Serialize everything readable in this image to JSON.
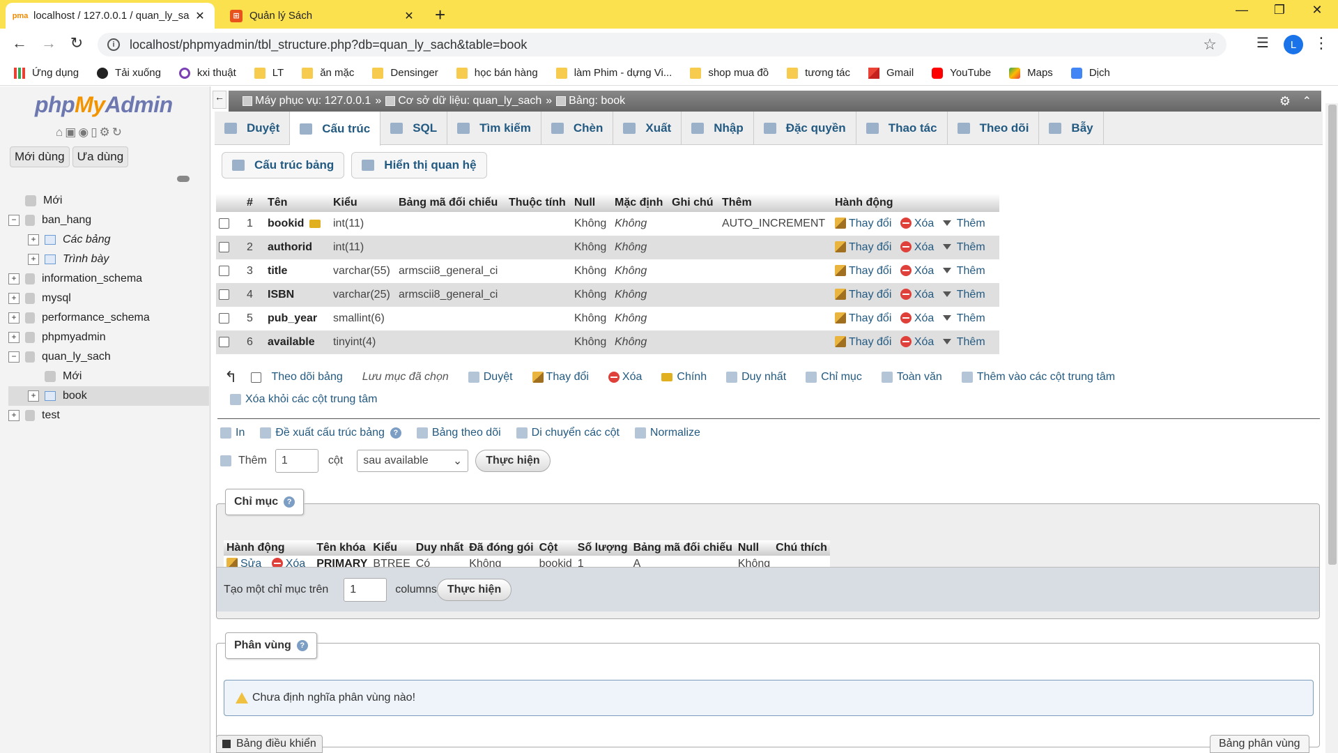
{
  "browser": {
    "tabs": [
      {
        "title": "localhost / 127.0.0.1 / quan_ly_sa",
        "active": true
      },
      {
        "title": "Quản lý Sách",
        "active": false
      }
    ],
    "url": "localhost/phpmyadmin/tbl_structure.php?db=quan_ly_sach&table=book",
    "avatar_letter": "L",
    "bookmarks": [
      {
        "label": "Ứng dụng",
        "icon": "apps-icon"
      },
      {
        "label": "Tải xuống",
        "icon": "download-icon"
      },
      {
        "label": "kxi thuật",
        "icon": "kxi-icon"
      },
      {
        "label": "LT",
        "icon": "folder-icon"
      },
      {
        "label": "ăn mặc",
        "icon": "folder-icon"
      },
      {
        "label": "Densinger",
        "icon": "folder-icon"
      },
      {
        "label": "học bán hàng",
        "icon": "folder-icon"
      },
      {
        "label": "làm Phim - dựng Vi...",
        "icon": "folder-icon"
      },
      {
        "label": "shop mua đồ",
        "icon": "folder-icon"
      },
      {
        "label": "tương tác",
        "icon": "folder-icon"
      },
      {
        "label": "Gmail",
        "icon": "gmail-icon"
      },
      {
        "label": "YouTube",
        "icon": "youtube-icon"
      },
      {
        "label": "Maps",
        "icon": "maps-icon"
      },
      {
        "label": "Dịch",
        "icon": "translate-icon"
      }
    ]
  },
  "sidebar": {
    "logo_php": "php",
    "logo_my": "My",
    "logo_admin": "Admin",
    "recent_label": "Mới dùng",
    "favorites_label": "Ưa dùng",
    "tree": {
      "new": "Mới",
      "ban_hang": "ban_hang",
      "cac_bang": "Các bảng",
      "trinh_bay": "Trình bày",
      "information_schema": "information_schema",
      "mysql": "mysql",
      "performance_schema": "performance_schema",
      "phpmyadmin": "phpmyadmin",
      "quan_ly_sach": "quan_ly_sach",
      "new_table": "Mới",
      "book": "book",
      "test": "test"
    }
  },
  "breadcrumb": {
    "server": "Máy phục vụ: 127.0.0.1",
    "database": "Cơ sở dữ liệu: quan_ly_sach",
    "table": "Bảng: book"
  },
  "tabs": [
    "Duyệt",
    "Cấu trúc",
    "SQL",
    "Tìm kiếm",
    "Chèn",
    "Xuất",
    "Nhập",
    "Đặc quyền",
    "Thao tác",
    "Theo dõi",
    "Bẫy"
  ],
  "active_tab": "Cấu trúc",
  "subtabs": [
    "Cấu trúc bảng",
    "Hiển thị quan hệ"
  ],
  "structure": {
    "headers": [
      "#",
      "Tên",
      "Kiểu",
      "Bảng mã đối chiếu",
      "Thuộc tính",
      "Null",
      "Mặc định",
      "Ghi chú",
      "Thêm",
      "Hành động"
    ],
    "rows": [
      {
        "num": "1",
        "name": "bookid",
        "type": "int(11)",
        "collation": "",
        "null": "Không",
        "default": "Không",
        "extra": "AUTO_INCREMENT"
      },
      {
        "num": "2",
        "name": "authorid",
        "type": "int(11)",
        "collation": "",
        "null": "Không",
        "default": "Không",
        "extra": ""
      },
      {
        "num": "3",
        "name": "title",
        "type": "varchar(55)",
        "collation": "armscii8_general_ci",
        "null": "Không",
        "default": "Không",
        "extra": ""
      },
      {
        "num": "4",
        "name": "ISBN",
        "type": "varchar(25)",
        "collation": "armscii8_general_ci",
        "null": "Không",
        "default": "Không",
        "extra": ""
      },
      {
        "num": "5",
        "name": "pub_year",
        "type": "smallint(6)",
        "collation": "",
        "null": "Không",
        "default": "Không",
        "extra": ""
      },
      {
        "num": "6",
        "name": "available",
        "type": "tinyint(4)",
        "collation": "",
        "null": "Không",
        "default": "Không",
        "extra": ""
      }
    ],
    "action_change": "Thay đổi",
    "action_drop": "Xóa",
    "action_more": "Thêm"
  },
  "bulk": {
    "check_all": "Theo dõi bảng",
    "with_selected": "Lưu mục đã chọn",
    "browse": "Duyệt",
    "change": "Thay đổi",
    "drop": "Xóa",
    "primary": "Chính",
    "unique": "Duy nhất",
    "index": "Chỉ mục",
    "fulltext": "Toàn văn",
    "add_central": "Thêm vào các cột trung tâm",
    "remove_central": "Xóa khỏi các cột trung tâm"
  },
  "tools": {
    "print": "In",
    "propose": "Đề xuất cấu trúc bảng",
    "track": "Bảng theo dõi",
    "move_columns": "Di chuyển các cột",
    "normalize": "Normalize"
  },
  "add_column": {
    "label": "Thêm",
    "count": "1",
    "unit": "cột",
    "position": "sau available",
    "go": "Thực hiện"
  },
  "indexes": {
    "legend": "Chỉ mục",
    "headers": [
      "Hành động",
      "Tên khóa",
      "Kiểu",
      "Duy nhất",
      "Đã đóng gói",
      "Cột",
      "Số lượng",
      "Bảng mã đối chiếu",
      "Null",
      "Chú thích"
    ],
    "row": {
      "edit": "Sửa",
      "drop": "Xóa",
      "key": "PRIMARY",
      "type": "BTREE",
      "unique": "Có",
      "packed": "Không",
      "column": "bookid",
      "cardinality": "1",
      "collation": "A",
      "null": "Không",
      "comment": ""
    },
    "create_label": "Tạo một chỉ mục trên",
    "create_count": "1",
    "create_unit": "columns",
    "go": "Thực hiện"
  },
  "partitions": {
    "legend": "Phân vùng",
    "message": "Chưa định nghĩa phân vùng nào!",
    "button": "Bảng phân vùng"
  },
  "console": {
    "label": "Bảng điều khiển"
  },
  "colors": {
    "accent_link": "#235a81",
    "tabbar": "#fce14f",
    "crumb": "#777777"
  }
}
